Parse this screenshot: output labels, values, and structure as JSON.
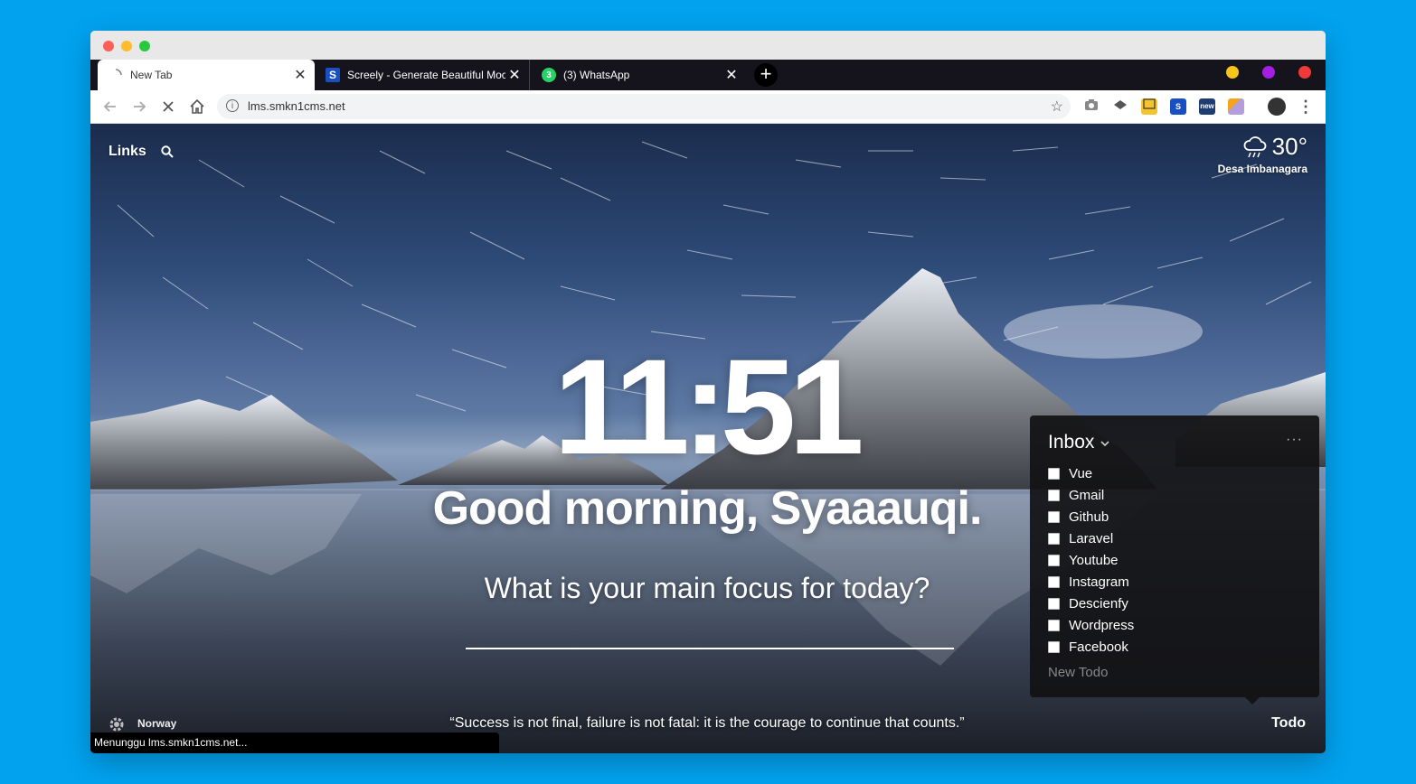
{
  "browser": {
    "tabs": [
      {
        "label": "New Tab",
        "icon": "loading-spinner-icon",
        "close": "✕"
      },
      {
        "label": "Screely - Generate Beautiful Mockups",
        "icon": "screely-logo-icon",
        "close": "✕"
      },
      {
        "label": "(3) WhatsApp",
        "icon": "whatsapp-icon",
        "badge": "3",
        "close": "✕"
      }
    ],
    "new_tab_label": "+",
    "url": "lms.smkn1cms.net",
    "status_text": "Menunggu lms.smkn1cms.net...",
    "extensions": [
      "camera-icon",
      "layers-icon",
      "cast-icon",
      "screely-ext-icon",
      "new-ext-icon",
      "color-picker-icon",
      "profile-avatar"
    ],
    "new_badge": "new",
    "sq_label": "S"
  },
  "momentum": {
    "links_label": "Links",
    "weather": {
      "temp": "30°",
      "location": "Desa Imbanagara",
      "icon": "rain-cloud-icon"
    },
    "clock": "11:51",
    "greeting": "Good morning, Syaaauqi.",
    "focus_question": "What is your main focus for today?",
    "photo_location": "Norway",
    "quote": "“Success is not final, failure is not fatal: it is the courage to continue that counts.”",
    "todo_button": "Todo",
    "todo": {
      "title": "Inbox",
      "more": "···",
      "items": [
        "Vue",
        "Gmail",
        "Github",
        "Laravel",
        "Youtube",
        "Instagram",
        "Descienfy",
        "Wordpress",
        "Facebook"
      ],
      "new_placeholder": "New Todo"
    }
  },
  "colors": {
    "background": "#02a2ef",
    "tabbar": "#15141c",
    "todo_panel": "#121214"
  }
}
